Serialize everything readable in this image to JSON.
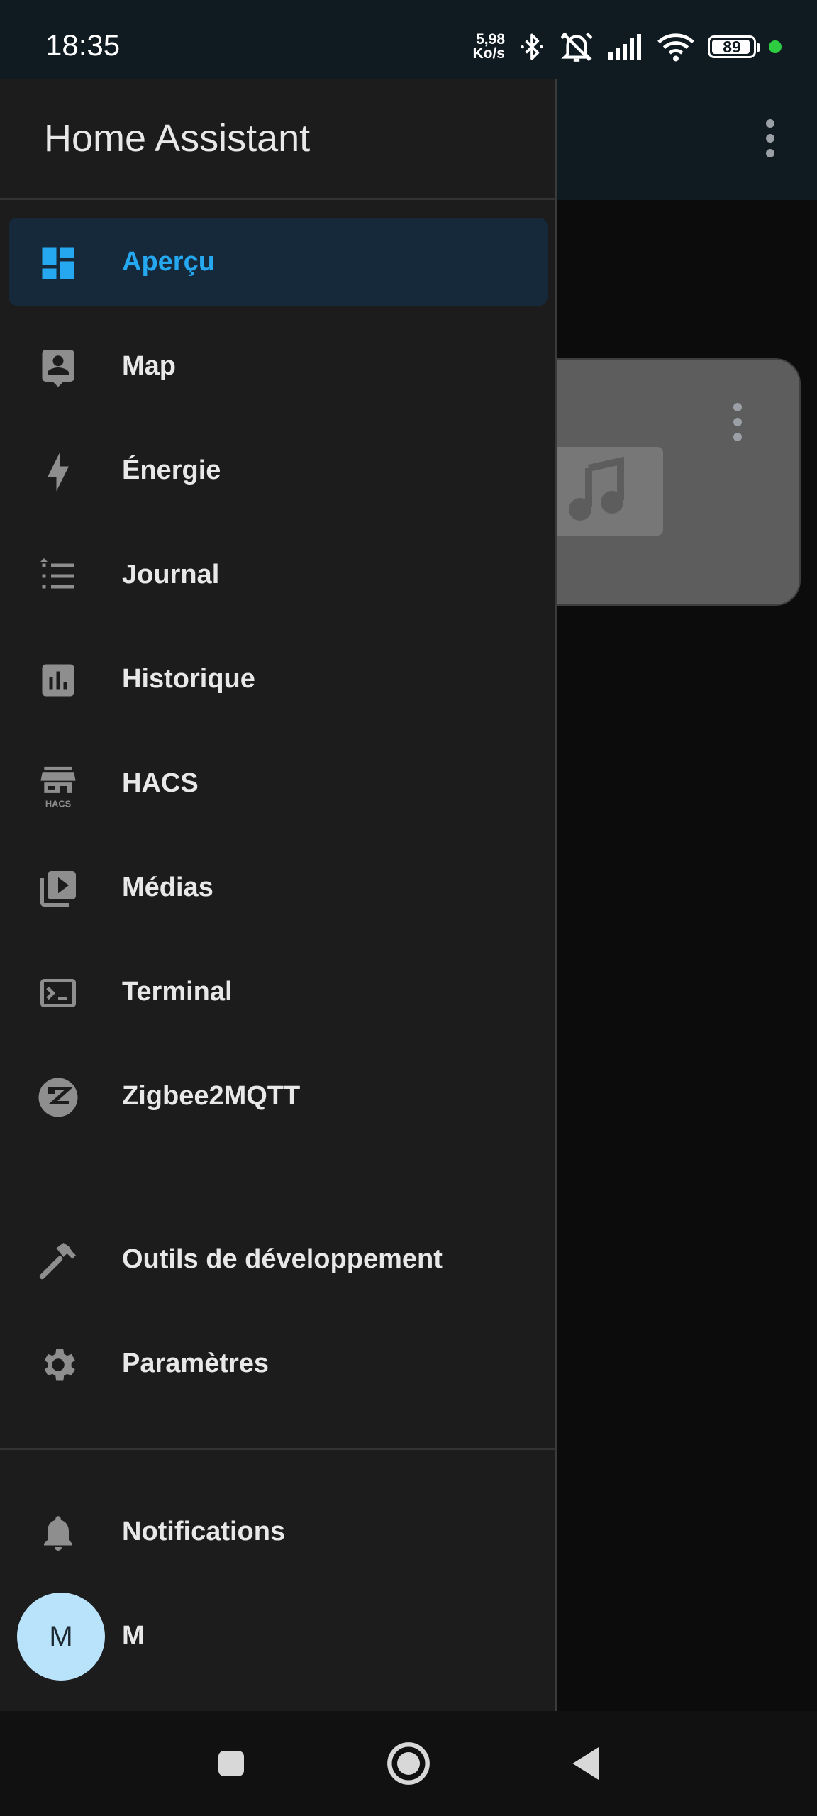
{
  "status_bar": {
    "time": "18:35",
    "speed_value": "5,98",
    "speed_unit": "Ko/s",
    "battery": "89",
    "icons": [
      "bluetooth-icon",
      "silent-alarm-icon",
      "signal-icon",
      "wifi-icon",
      "battery-icon",
      "privacy-dot"
    ]
  },
  "drawer": {
    "title": "Home Assistant",
    "items": [
      {
        "label": "Aperçu",
        "icon": "dashboard-icon",
        "active": true
      },
      {
        "label": "Map",
        "icon": "map-person-icon"
      },
      {
        "label": "Énergie",
        "icon": "lightning-icon"
      },
      {
        "label": "Journal",
        "icon": "list-icon"
      },
      {
        "label": "Historique",
        "icon": "chart-icon"
      },
      {
        "label": "HACS",
        "icon": "hacs-store-icon"
      },
      {
        "label": "Médias",
        "icon": "media-play-icon"
      },
      {
        "label": "Terminal",
        "icon": "terminal-icon"
      },
      {
        "label": "Zigbee2MQTT",
        "icon": "zigbee-icon"
      }
    ],
    "tools": [
      {
        "label": "Outils de développement",
        "icon": "hammer-icon"
      },
      {
        "label": "Paramètres",
        "icon": "gear-icon"
      }
    ],
    "notifications_label": "Notifications",
    "user": {
      "initial": "M",
      "name": "M"
    }
  },
  "hacs_icon_text": "HACS",
  "colors": {
    "accent": "#25a8f0",
    "drawer_bg": "#1c1c1c",
    "avatar_bg": "#b9e3fb"
  }
}
